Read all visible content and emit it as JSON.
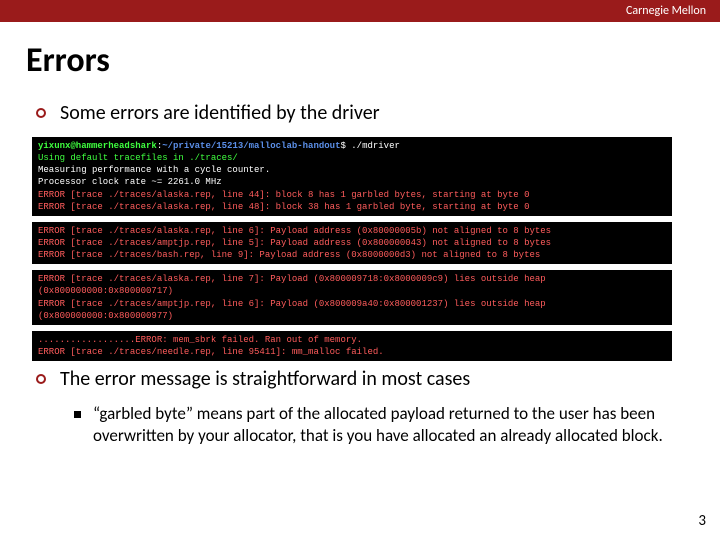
{
  "header": {
    "institution": "Carnegie Mellon"
  },
  "title": "Errors",
  "bullets": {
    "b1": "Some errors are identified by the driver",
    "b2": "The error message is straightforward in most cases"
  },
  "subbullet": "“garbled byte” means part of the allocated payload returned to the user has been overwritten by your allocator, that is you have allocated an already allocated block.",
  "terminal": {
    "prompt_user": "yixunx@hammerheadshark",
    "prompt_path": "~/private/15213/malloclab-handout",
    "cmd": "$ ./mdriver",
    "block1": {
      "l1": "Using default tracefiles in ./traces/",
      "l2": "Measuring performance with a cycle counter.",
      "l3": "Processor clock rate ~= 2261.0 MHz",
      "l4": "ERROR [trace ./traces/alaska.rep, line 44]: block 8 has 1 garbled bytes, starting at byte 0",
      "l5": "ERROR [trace ./traces/alaska.rep, line 48]: block 38 has 1 garbled byte, starting at byte 0"
    },
    "block2": {
      "l1": "ERROR [trace ./traces/alaska.rep, line 6]: Payload address (0x80000005b) not aligned to 8 bytes",
      "l2": "ERROR [trace ./traces/amptjp.rep, line 5]: Payload address (0x800000043) not aligned to 8 bytes",
      "l3": "ERROR [trace ./traces/bash.rep, line 9]: Payload address (0x8000000d3) not aligned to 8 bytes"
    },
    "block3": {
      "l1": "ERROR [trace ./traces/alaska.rep, line 7]: Payload (0x800009718:0x8000009c9) lies outside heap (0x800000000:0x800000717)",
      "l2": "ERROR [trace ./traces/amptjp.rep, line 6]: Payload (0x800009a40:0x800001237) lies outside heap (0x800000000:0x800000977)"
    },
    "block4": {
      "l1": "..................ERROR: mem_sbrk failed. Ran out of memory.",
      "l2": "ERROR [trace ./traces/needle.rep, line 95411]: mm_malloc failed."
    }
  },
  "slide_number": "3"
}
